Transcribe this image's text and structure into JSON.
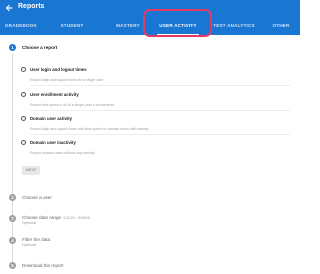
{
  "app": {
    "title": "Reports"
  },
  "tabs": [
    {
      "label": "GRADEBOOK",
      "active": false
    },
    {
      "label": "STUDENT",
      "active": false
    },
    {
      "label": "MASTERY",
      "active": false
    },
    {
      "label": "USER ACTIVITY",
      "active": true
    },
    {
      "label": "TEST ANALYTICS",
      "active": false
    },
    {
      "label": "OTHER",
      "active": false
    }
  ],
  "steps": [
    {
      "number": "1",
      "label": "Choose a report",
      "active": true
    },
    {
      "number": "2",
      "label": "Choose a user",
      "active": false
    },
    {
      "number": "3",
      "label": "Choose date range",
      "date": "9/11/20 - 9/18/20",
      "sub": "Optional",
      "active": false
    },
    {
      "number": "4",
      "label": "Filter the data",
      "sub": "Optional",
      "active": false
    },
    {
      "number": "5",
      "label": "Download the report",
      "active": false
    }
  ],
  "report_options": [
    {
      "title": "User login and logout times",
      "description": "Report login and logout times for a single user"
    },
    {
      "title": "User enrollment activity",
      "description": "Report time spent in all of a single user's enrollments"
    },
    {
      "title": "Domain user activity",
      "description": "Report login and logout times and time spent for domain users with activity"
    },
    {
      "title": "Domain user inactivity",
      "description": "Report domain users without any activity"
    }
  ],
  "next_button": {
    "label": "NEXT"
  },
  "colors": {
    "header": "#1976d2",
    "highlight": "#e23a64",
    "active_step": "#1976d2"
  }
}
